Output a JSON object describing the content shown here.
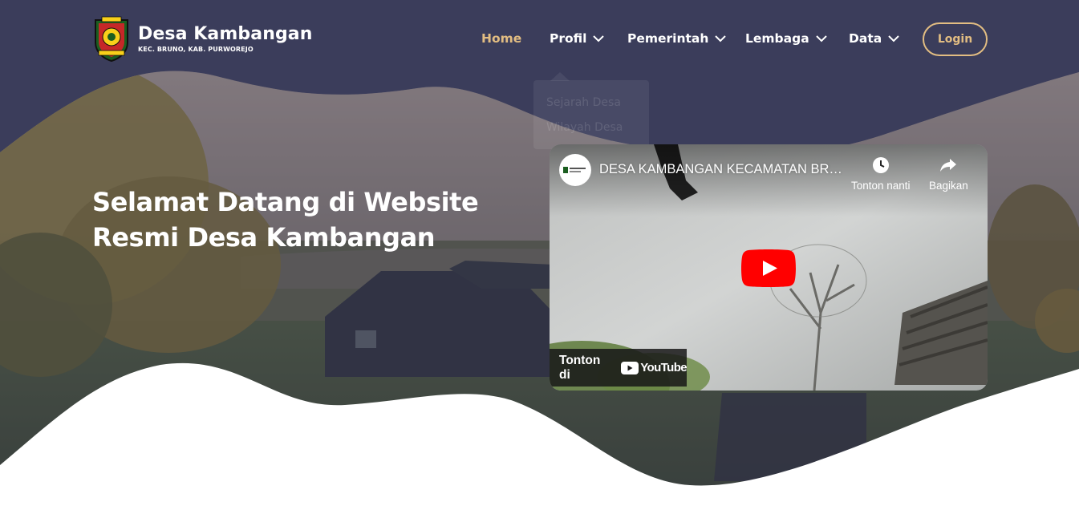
{
  "brand": {
    "title": "Desa Kambangan",
    "subtitle": "KEC. BRUNO, KAB. PURWOREJO",
    "logo_icon": "village-crest-icon"
  },
  "nav": {
    "items": [
      {
        "label": "Home",
        "active": true,
        "has_dropdown": false
      },
      {
        "label": "Profil",
        "active": false,
        "has_dropdown": true
      },
      {
        "label": "Pemerintah",
        "active": false,
        "has_dropdown": true
      },
      {
        "label": "Lembaga",
        "active": false,
        "has_dropdown": true
      },
      {
        "label": "Data",
        "active": false,
        "has_dropdown": true
      }
    ],
    "login_label": "Login"
  },
  "dropdown": {
    "items": [
      "Sejarah Desa",
      "Wilayah Desa"
    ]
  },
  "hero": {
    "headline_line1": "Selamat Datang di Website",
    "headline_line2": "Resmi Desa Kambangan"
  },
  "video": {
    "title": "DESA KAMBANGAN KECAMATAN BRUNO",
    "watch_later": "Tonton nanti",
    "share": "Bagikan",
    "watch_on": "Tonton di",
    "youtube": "YouTube"
  },
  "colors": {
    "navy": "#3b3d5b",
    "accent": "#e2bd82",
    "youtube_red": "#ff0000"
  }
}
